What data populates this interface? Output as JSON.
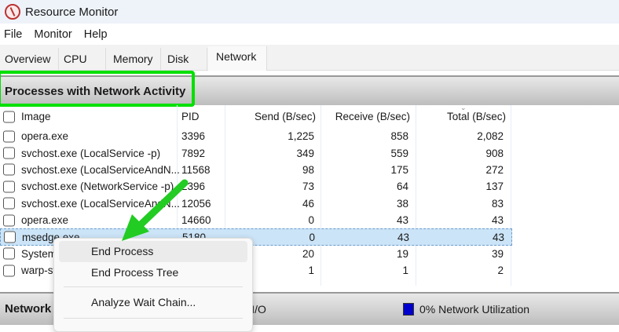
{
  "window": {
    "title": "Resource Monitor"
  },
  "menu": [
    "File",
    "Monitor",
    "Help"
  ],
  "tabs": [
    "Overview",
    "CPU",
    "Memory",
    "Disk",
    "Network"
  ],
  "section": {
    "title": "Processes with Network Activity"
  },
  "columns": [
    "Image",
    "PID",
    "Send (B/sec)",
    "Receive (B/sec)",
    "Total (B/sec)"
  ],
  "rows": [
    {
      "image": "opera.exe",
      "pid": "3396",
      "send": "1,225",
      "recv": "858",
      "total": "2,082"
    },
    {
      "image": "svchost.exe (LocalService -p)",
      "pid": "7892",
      "send": "349",
      "recv": "559",
      "total": "908"
    },
    {
      "image": "svchost.exe (LocalServiceAndN...",
      "pid": "11568",
      "send": "98",
      "recv": "175",
      "total": "272"
    },
    {
      "image": "svchost.exe (NetworkService -p)",
      "pid": "2396",
      "send": "73",
      "recv": "64",
      "total": "137"
    },
    {
      "image": "svchost.exe (LocalServiceAndN...",
      "pid": "12056",
      "send": "46",
      "recv": "38",
      "total": "83"
    },
    {
      "image": "opera.exe",
      "pid": "14660",
      "send": "0",
      "recv": "43",
      "total": "43"
    },
    {
      "image": "msedge.exe",
      "pid": "5180",
      "send": "0",
      "recv": "43",
      "total": "43"
    },
    {
      "image": "System",
      "pid": "",
      "send": "20",
      "recv": "19",
      "total": "39"
    },
    {
      "image": "warp-svc.exe",
      "pid": "",
      "send": "1",
      "recv": "1",
      "total": "2"
    }
  ],
  "bottom": {
    "title": "Network",
    "io": "Network I/O",
    "util": "0% Network Utilization"
  },
  "context_menu": [
    "End Process",
    "End Process Tree",
    "Analyze Wait Chain..."
  ],
  "colors": {
    "highlight": "#00e000",
    "util_box": "#0000cc"
  }
}
